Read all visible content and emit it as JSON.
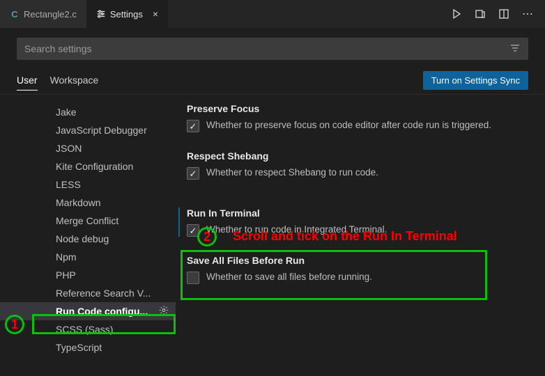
{
  "tabs": {
    "items": [
      {
        "label": "Rectangle2.c",
        "icon": "C",
        "active": false
      },
      {
        "label": "Settings",
        "icon": "settings",
        "active": true
      }
    ]
  },
  "toolbar": {
    "run_icon": "run",
    "open_icon": "open-preview",
    "split_icon": "split",
    "more_icon": "more"
  },
  "search": {
    "placeholder": "Search settings",
    "value": ""
  },
  "scope": {
    "tabs": [
      {
        "label": "User",
        "active": true
      },
      {
        "label": "Workspace",
        "active": false
      }
    ],
    "sync_button": "Turn on Settings Sync"
  },
  "sidebar": {
    "items": [
      {
        "label": "Jake"
      },
      {
        "label": "JavaScript Debugger"
      },
      {
        "label": "JSON"
      },
      {
        "label": "Kite Configuration"
      },
      {
        "label": "LESS"
      },
      {
        "label": "Markdown"
      },
      {
        "label": "Merge Conflict"
      },
      {
        "label": "Node debug"
      },
      {
        "label": "Npm"
      },
      {
        "label": "PHP"
      },
      {
        "label": "Reference Search V..."
      },
      {
        "label": "Run Code configu...",
        "selected": true,
        "gear": true
      },
      {
        "label": "SCSS (Sass)"
      },
      {
        "label": "TypeScript"
      }
    ]
  },
  "settings": [
    {
      "title": "Preserve Focus",
      "checked": true,
      "desc": "Whether to preserve focus on code editor after code run is triggered."
    },
    {
      "title": "Respect Shebang",
      "checked": true,
      "desc": "Whether to respect Shebang to run code."
    },
    {
      "title": "Run In Terminal",
      "checked": true,
      "highlighted": true,
      "desc": "Whether to run code in Integrated Terminal."
    },
    {
      "title": "Save All Files Before Run",
      "checked": false,
      "desc": "Whether to save all files before running."
    }
  ],
  "annotations": {
    "label1": "1",
    "label2": "2",
    "text2": "Scroll and tick on the Run In Terminal"
  }
}
